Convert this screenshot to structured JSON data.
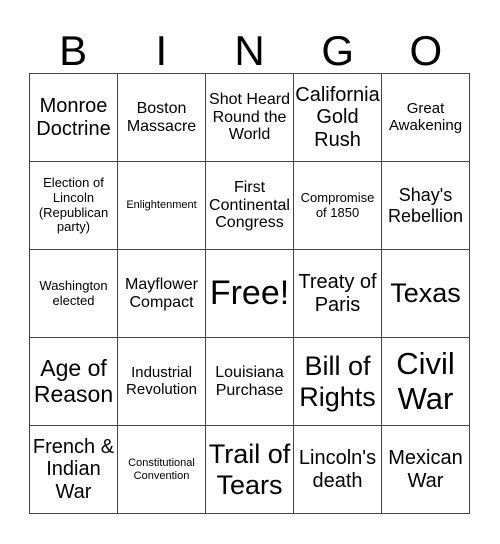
{
  "header": {
    "letters": [
      "B",
      "I",
      "N",
      "G",
      "O"
    ]
  },
  "card": {
    "rows": [
      [
        "Monroe Doctrine",
        "Boston Massacre",
        "Shot Heard Round the World",
        "California Gold Rush",
        "Great Awakening"
      ],
      [
        "Election of Lincoln (Republican party)",
        "Enlightenment",
        "First Continental Congress",
        "Compromise of 1850",
        "Shay's Rebellion"
      ],
      [
        "Washington elected",
        "Mayflower Compact",
        "Free!",
        "Treaty of Paris",
        "Texas"
      ],
      [
        "Age of Reason",
        "Industrial Revolution",
        "Louisiana Purchase",
        "Bill of Rights",
        "Civil War"
      ],
      [
        "French & Indian War",
        "Constitutional Convention",
        "Trail of Tears",
        "Lincoln's death",
        "Mexican War"
      ]
    ]
  },
  "colors": {
    "grid_line": "#444444",
    "text": "#000000",
    "background": "#ffffff"
  }
}
